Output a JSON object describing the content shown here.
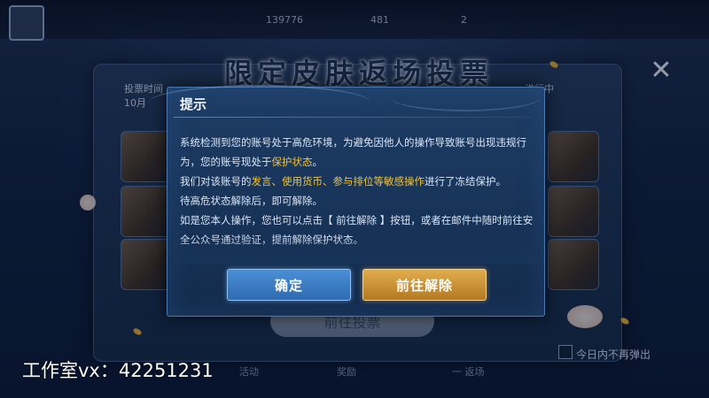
{
  "topbar": {
    "currency_1": "139776",
    "currency_2": "481",
    "currency_3": "2"
  },
  "poster": {
    "title": "限定皮肤返场投票",
    "left_date_label": "投票时间",
    "left_month": "10月",
    "right_status": "进行中",
    "vote_button": "前往投票"
  },
  "bottom_tabs": [
    "活动",
    "奖励",
    "一 返场"
  ],
  "close_label": "✕",
  "no_show_today": "今日内不再弹出",
  "dialog": {
    "title": "提示",
    "body": {
      "p1_a": "系统检测到您的账号处于高危环境，为避免因他人的操作导致账号出现违规行为，您的账号现处于",
      "p1_hl": "保护状态",
      "p1_b": "。",
      "p2_a": "我们对该账号的",
      "p2_hl1": "发言、使用货币、参与排位等敏感操作",
      "p2_b": "进行了冻结保护。",
      "p3": "待高危状态解除后，即可解除。",
      "p4": "如是您本人操作，您也可以点击【 前往解除 】按钮，或者在邮件中随时前往安全公众号通过验证，提前解除保护状态。"
    },
    "confirm_button": "确定",
    "unlock_button": "前往解除"
  },
  "watermark": "工作室vx：42251231",
  "colors": {
    "highlight": "#f3c233",
    "confirm": "#3a7cc4",
    "unlock": "#c98f35"
  }
}
